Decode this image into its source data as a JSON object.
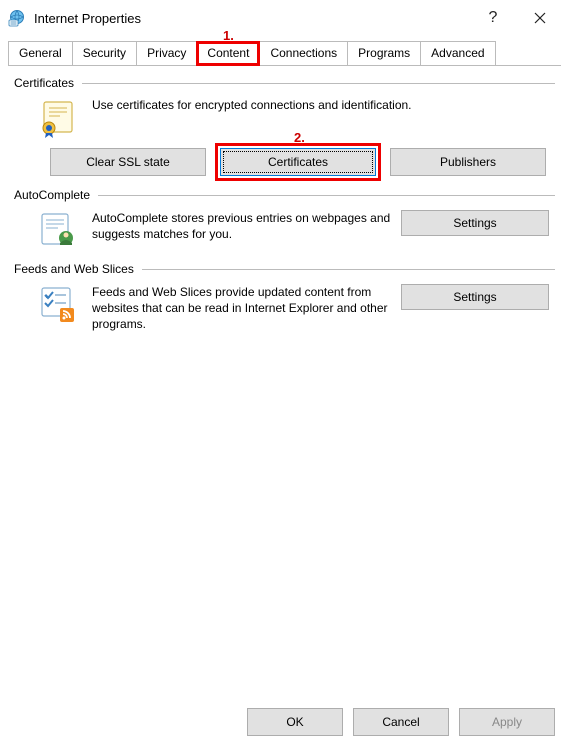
{
  "window": {
    "title": "Internet Properties",
    "help_glyph": "?",
    "close_glyph": "✕"
  },
  "annotations": {
    "one": "1.",
    "two": "2."
  },
  "tabs": {
    "items": [
      {
        "label": "General"
      },
      {
        "label": "Security"
      },
      {
        "label": "Privacy"
      },
      {
        "label": "Content"
      },
      {
        "label": "Connections"
      },
      {
        "label": "Programs"
      },
      {
        "label": "Advanced"
      }
    ],
    "active_index": 3
  },
  "certificates_group": {
    "title": "Certificates",
    "description": "Use certificates for encrypted connections and identification.",
    "buttons": {
      "clear_ssl": "Clear SSL state",
      "certificates": "Certificates",
      "publishers": "Publishers"
    }
  },
  "autocomplete_group": {
    "title": "AutoComplete",
    "description": "AutoComplete stores previous entries on webpages and suggests matches for you.",
    "settings_label": "Settings"
  },
  "feeds_group": {
    "title": "Feeds and Web Slices",
    "description": "Feeds and Web Slices provide updated content from websites that can be read in Internet Explorer and other programs.",
    "settings_label": "Settings"
  },
  "dialog_buttons": {
    "ok": "OK",
    "cancel": "Cancel",
    "apply": "Apply"
  }
}
